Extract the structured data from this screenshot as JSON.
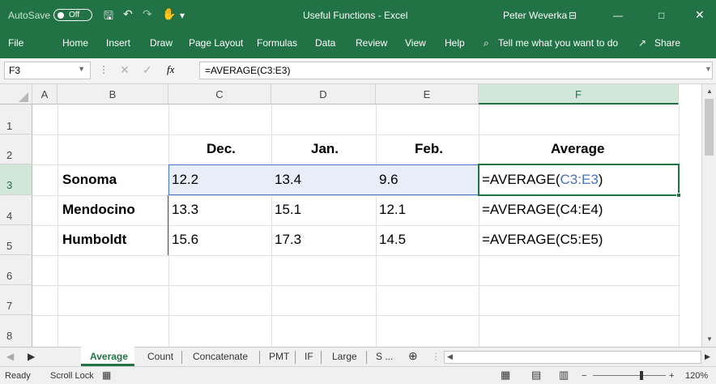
{
  "titlebar": {
    "autosave_label": "AutoSave",
    "autosave_state": "Off",
    "doc_title": "Useful Functions  -  Excel",
    "user": "Peter Weverka"
  },
  "ribbon": {
    "tabs": [
      "File",
      "Home",
      "Insert",
      "Draw",
      "Page Layout",
      "Formulas",
      "Data",
      "Review",
      "View",
      "Help"
    ],
    "tell_me": "Tell me what you want to do",
    "share": "Share"
  },
  "formula_bar": {
    "name_box": "F3",
    "fx": "fx",
    "formula": "=AVERAGE(C3:E3)"
  },
  "grid": {
    "columns": [
      "A",
      "B",
      "C",
      "D",
      "E",
      "F"
    ],
    "rows": [
      "1",
      "2",
      "3",
      "4",
      "5",
      "6",
      "7",
      "8"
    ],
    "headers": {
      "c": "Dec.",
      "d": "Jan.",
      "e": "Feb.",
      "f": "Average"
    },
    "data": [
      {
        "label": "Sonoma",
        "c": "12.2",
        "d": "13.4",
        "e": "9.6",
        "f_prefix": "=AVERAGE(",
        "f_ref": "C3:E3",
        "f_suffix": ")"
      },
      {
        "label": "Mendocino",
        "c": "13.3",
        "d": "15.1",
        "e": "12.1",
        "f": "=AVERAGE(C4:E4)"
      },
      {
        "label": "Humboldt",
        "c": "15.6",
        "d": "17.3",
        "e": "14.5",
        "f": "=AVERAGE(C5:E5)"
      }
    ]
  },
  "sheet_tabs": [
    "Average",
    "Count",
    "Concatenate",
    "PMT",
    "IF",
    "Large",
    "S ..."
  ],
  "status": {
    "mode": "Ready",
    "scroll_lock": "Scroll Lock",
    "zoom": "120%"
  },
  "colors": {
    "excel_green": "#217346",
    "selection_fill": "#e8eef8",
    "selection_border": "#4472c4",
    "ref_blue": "#4472c4"
  }
}
